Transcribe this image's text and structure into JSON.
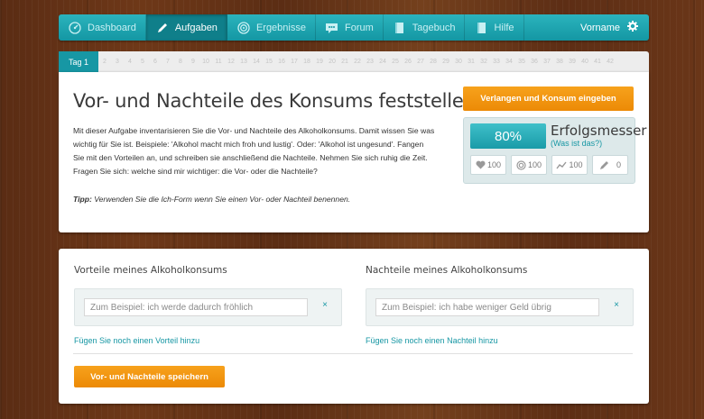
{
  "nav": {
    "items": [
      {
        "label": "Dashboard",
        "icon": "dashboard-icon",
        "active": false
      },
      {
        "label": "Aufgaben",
        "icon": "pencil-icon",
        "active": true
      },
      {
        "label": "Ergebnisse",
        "icon": "target-icon",
        "active": false
      },
      {
        "label": "Forum",
        "icon": "chat-bubble-icon",
        "active": false
      },
      {
        "label": "Tagebuch",
        "icon": "book-icon",
        "active": false
      },
      {
        "label": "Hilfe",
        "icon": "help-book-icon",
        "active": false
      }
    ],
    "user_name": "Vorname",
    "user_icon": "gear-icon"
  },
  "days": {
    "active_label": "Tag 1",
    "others": [
      "2",
      "3",
      "4",
      "5",
      "6",
      "7",
      "8",
      "9",
      "10",
      "11",
      "12",
      "13",
      "14",
      "15",
      "16",
      "17",
      "18",
      "19",
      "20",
      "21",
      "22",
      "23",
      "24",
      "25",
      "26",
      "27",
      "28",
      "29",
      "30",
      "31",
      "32",
      "33",
      "34",
      "35",
      "36",
      "37",
      "38",
      "39",
      "40",
      "41",
      "42"
    ]
  },
  "task": {
    "title": "Vor- und Nachteile des Konsums feststellen",
    "description": "Mit dieser Aufgabe inventarisieren Sie die Vor- und Nachteile des Alkoholkonsums. Damit wissen Sie was wichtig für Sie ist. Beispiele: 'Alkohol macht mich froh und lustig'. Oder: 'Alkohol ist ungesund'. Fangen Sie mit den Vorteilen an, und schreiben sie anschließend die Nachteile. Nehmen Sie sich ruhig die Zeit. Fragen Sie sich: welche sind mir wichtiger: die Vor- oder die Nachteile?",
    "tip_label": "Tipp:",
    "tip_text": "Verwenden Sie die Ich-Form wenn Sie einen Vor- oder Nachteil benennen."
  },
  "sidebar": {
    "button_label": "Verlangen und Konsum eingeben",
    "progress_text": "80%",
    "progress_value": 80,
    "meter_label": "Erfolgsmesser",
    "meter_link": "(Was ist das?)",
    "stats": [
      {
        "icon": "heart-icon",
        "value": "100"
      },
      {
        "icon": "target-icon",
        "value": "100"
      },
      {
        "icon": "trend-icon",
        "value": "100"
      },
      {
        "icon": "pencil-icon",
        "value": "0"
      }
    ]
  },
  "form": {
    "pros": {
      "heading": "Vorteile meines Alkoholkonsums",
      "placeholder": "Zum Beispiel: ich werde dadurch fröhlich",
      "remove": "×",
      "add_link": "Fügen Sie noch einen Vorteil hinzu"
    },
    "cons": {
      "heading": "Nachteile meines Alkoholkonsums",
      "placeholder": "Zum Beispiel: ich habe weniger Geld übrig",
      "remove": "×",
      "add_link": "Fügen Sie noch einen Nachteil hinzu"
    },
    "save_label": "Vor- und Nachteile speichern"
  },
  "colors": {
    "accent": "#1797a4",
    "orange": "#f39a11"
  }
}
